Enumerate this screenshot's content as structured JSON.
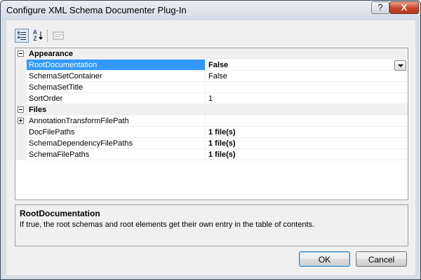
{
  "window": {
    "title": "Configure XML Schema Documenter Plug-In",
    "help_label": "?",
    "close_label": "X"
  },
  "toolbar": {
    "categorized_icon": "categorized-view-icon",
    "alphabetical_icon": "alphabetical-sort-icon",
    "alphabetical_label": "A Z",
    "property_pages_icon": "property-pages-icon"
  },
  "grid": {
    "categories": [
      {
        "label": "Appearance",
        "expanded": true,
        "properties": [
          {
            "name": "RootDocumentation",
            "value": "False",
            "bold": true,
            "selected": true
          },
          {
            "name": "SchemaSetContainer",
            "value": "False",
            "bold": false,
            "selected": false
          },
          {
            "name": "SchemaSetTitle",
            "value": "",
            "bold": false,
            "selected": false
          },
          {
            "name": "SortOrder",
            "value": "1",
            "bold": false,
            "selected": false
          }
        ]
      },
      {
        "label": "Files",
        "expanded": true,
        "properties": [
          {
            "name": "AnnotationTransformFilePath",
            "value": "",
            "bold": false,
            "selected": false,
            "expandable": true
          },
          {
            "name": "DocFilePaths",
            "value": "1 file(s)",
            "bold": true,
            "selected": false
          },
          {
            "name": "SchemaDependencyFilePaths",
            "value": "1 file(s)",
            "bold": true,
            "selected": false
          },
          {
            "name": "SchemaFilePaths",
            "value": "1 file(s)",
            "bold": true,
            "selected": false
          }
        ]
      }
    ]
  },
  "description": {
    "title": "RootDocumentation",
    "text": "If true, the root schemas and root elements get their own entry in the table of contents."
  },
  "buttons": {
    "ok": "OK",
    "cancel": "Cancel"
  },
  "colors": {
    "selection": "#3399ff",
    "gutter": "#f0f0f0",
    "close_button": "#c8442a"
  }
}
